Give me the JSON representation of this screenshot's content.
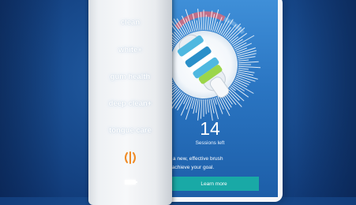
{
  "brush": {
    "modes": [
      "clean",
      "white+",
      "gum health",
      "deep clean+",
      "tongue care"
    ]
  },
  "app": {
    "sessions_count": "14",
    "sessions_label": "Sessions left",
    "desc_line1": "now, to have a new, effective brush",
    "desc_line2": "nd in time to achieve your goal.",
    "button_label": "Learn more"
  },
  "icons": {
    "intensity": "intensity-level-icon",
    "battery": "battery-icon"
  },
  "colors": {
    "background_blue": "#1a4f93",
    "screen_blue": "#2a75c2",
    "button_teal": "#19a9a6",
    "gauge_pink": "#c0708a"
  }
}
